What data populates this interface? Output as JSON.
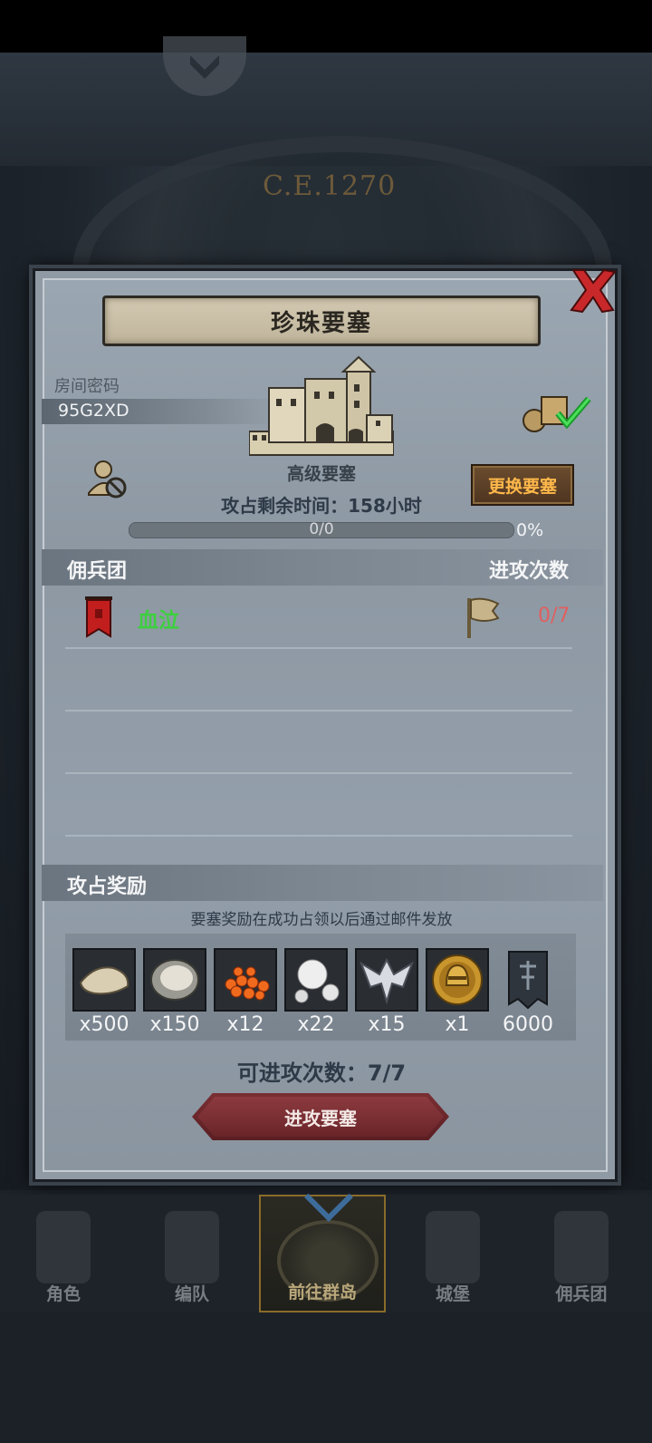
{
  "header": {
    "era": "C.E.1270"
  },
  "modal": {
    "title": "珍珠要塞",
    "room_label": "房间密码",
    "room_code": "95G2XD",
    "fort_level": "高级要塞",
    "change_button": "更换要塞",
    "remaining_time": "攻占剩余时间：158小时",
    "progress_text": "0/0",
    "progress_percent_text": "0%",
    "progress_fraction": 0,
    "mercenary_section": {
      "title": "佣兵团",
      "attacks_header": "进攻次数",
      "rows": [
        {
          "name": "血泣",
          "attacks": "0/7"
        }
      ]
    },
    "reward_section": {
      "title": "攻占奖励",
      "note": "要塞奖励在成功占领以后通过邮件发放",
      "items": [
        {
          "icon": "shell-icon",
          "qty": "x500"
        },
        {
          "icon": "oyster-icon",
          "qty": "x150"
        },
        {
          "icon": "fish-roe-icon",
          "qty": "x12"
        },
        {
          "icon": "pearl-icon",
          "qty": "x22"
        },
        {
          "icon": "silver-emblem-icon",
          "qty": "x15"
        },
        {
          "icon": "gold-helmet-coin-icon",
          "qty": "x1"
        },
        {
          "icon": "guild-banner-icon",
          "qty": "6000"
        }
      ]
    },
    "attack_left": "可进攻次数：7/7",
    "attack_button": "进攻要塞"
  },
  "nav": [
    {
      "label": "角色",
      "icon": "knight-icon"
    },
    {
      "label": "编队",
      "icon": "formation-icon"
    },
    {
      "label": "前往群岛",
      "icon": "islands-icon",
      "active": true
    },
    {
      "label": "城堡",
      "icon": "castle-icon"
    },
    {
      "label": "佣兵团",
      "icon": "ship-icon"
    }
  ],
  "colors": {
    "merc_name": "#3dcf3f",
    "attack_count": "#e06060",
    "change_button_text": "#ffb84a",
    "close_x": "#d42a2a"
  }
}
